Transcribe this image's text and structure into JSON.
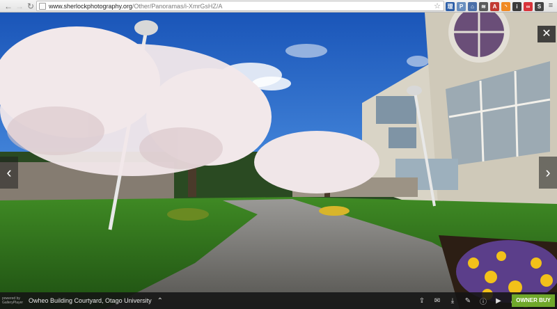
{
  "browser": {
    "url_host": "www.sherlockphotography.org",
    "url_path": "/Other/Panoramas/i-XmrGsHZ/A",
    "extensions": [
      {
        "name": "ext-blue-icon",
        "label": "理",
        "color": "#2d5fa8"
      },
      {
        "name": "ext-pocket-icon",
        "label": "P",
        "color": "#6a8fbf"
      },
      {
        "name": "ext-home-icon",
        "label": "⌂",
        "color": "#4b6fa8"
      },
      {
        "name": "ext-feed-icon",
        "label": "≋",
        "color": "#5a5a5a"
      },
      {
        "name": "ext-lastpass-icon",
        "label": "A",
        "color": "#c23a32"
      },
      {
        "name": "ext-rss-icon",
        "label": "◝",
        "color": "#f08a24"
      },
      {
        "name": "ext-info-icon",
        "label": "i",
        "color": "#3b3b3b"
      },
      {
        "name": "ext-glasses-icon",
        "label": "∞",
        "color": "#d8333a"
      },
      {
        "name": "ext-s-icon",
        "label": "S",
        "color": "#444"
      }
    ]
  },
  "viewer": {
    "close": "✕",
    "prev": "‹",
    "next": "›",
    "caption": "Owheo Building Courtyard, Otago University",
    "powered_by": "powered by GalleryPlayer",
    "owner_buy": "OWNER BUY",
    "tools": [
      {
        "name": "share-icon",
        "glyph": "⇪"
      },
      {
        "name": "comment-icon",
        "glyph": "✉"
      },
      {
        "name": "download-icon",
        "glyph": "⤓"
      },
      {
        "name": "edit-icon",
        "glyph": "✎"
      },
      {
        "name": "info-icon",
        "glyph": "ⓘ"
      },
      {
        "name": "play-icon",
        "glyph": "▶"
      },
      {
        "name": "fullscreen-icon",
        "glyph": "⤢"
      }
    ]
  }
}
